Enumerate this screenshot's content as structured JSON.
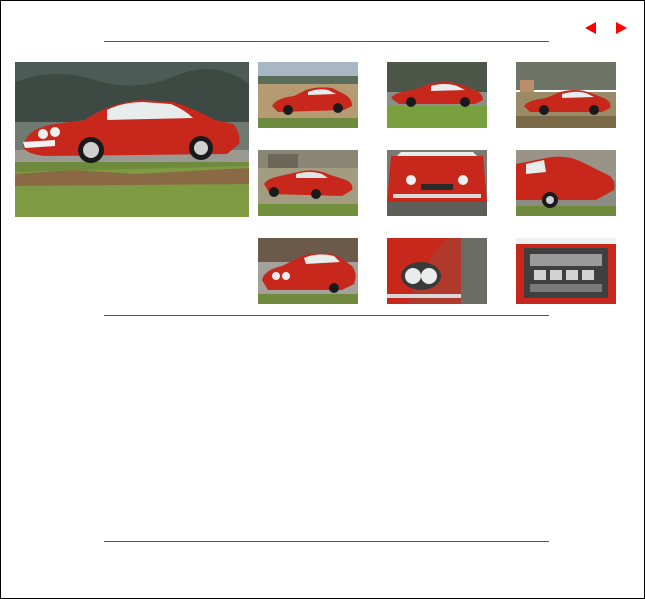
{
  "navigation": {
    "prev_icon": "triangle-left-icon",
    "next_icon": "triangle-right-icon",
    "arrow_color": "#ff0000"
  },
  "theme": {
    "rule_color": "#2e6b57",
    "car_color": "#c8281c"
  },
  "gallery": {
    "main": {
      "view": "front-three-quarter"
    },
    "thumbnails": [
      {
        "view": "side-field"
      },
      {
        "view": "side-profile"
      },
      {
        "view": "side-right-field"
      },
      {
        "view": "rear-three-quarter"
      },
      {
        "view": "front-hood"
      },
      {
        "view": "rear-close"
      },
      {
        "view": "front-low"
      },
      {
        "view": "headlight-detail"
      },
      {
        "view": "engine-bay"
      }
    ]
  }
}
